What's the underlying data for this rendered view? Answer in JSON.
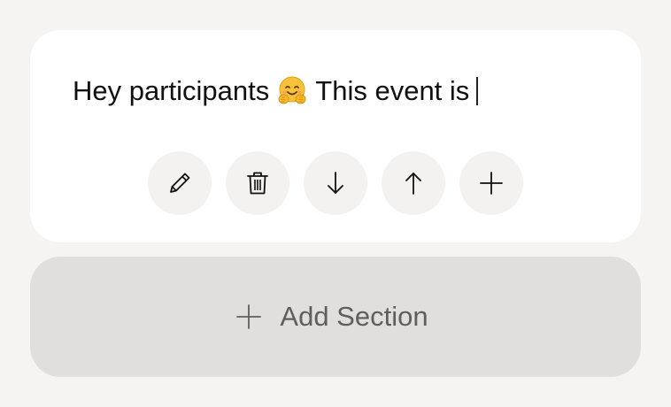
{
  "editor": {
    "text_before_emoji": "Hey participants",
    "emoji_icon": "hugging-face-emoji",
    "text_after_emoji": "This event is"
  },
  "toolbar": {
    "buttons": [
      {
        "icon": "pencil-icon",
        "action": "edit"
      },
      {
        "icon": "trash-icon",
        "action": "delete"
      },
      {
        "icon": "arrow-down-icon",
        "action": "move-down"
      },
      {
        "icon": "arrow-up-icon",
        "action": "move-up"
      },
      {
        "icon": "plus-icon",
        "action": "add"
      }
    ]
  },
  "add_section": {
    "icon": "plus-icon",
    "label": "Add Section"
  },
  "colors": {
    "page_background": "#f5f4f2",
    "card_background": "#ffffff",
    "button_background": "#f3f2f0",
    "add_section_background": "#e0dfdd",
    "add_section_text": "#5f5e5c"
  }
}
